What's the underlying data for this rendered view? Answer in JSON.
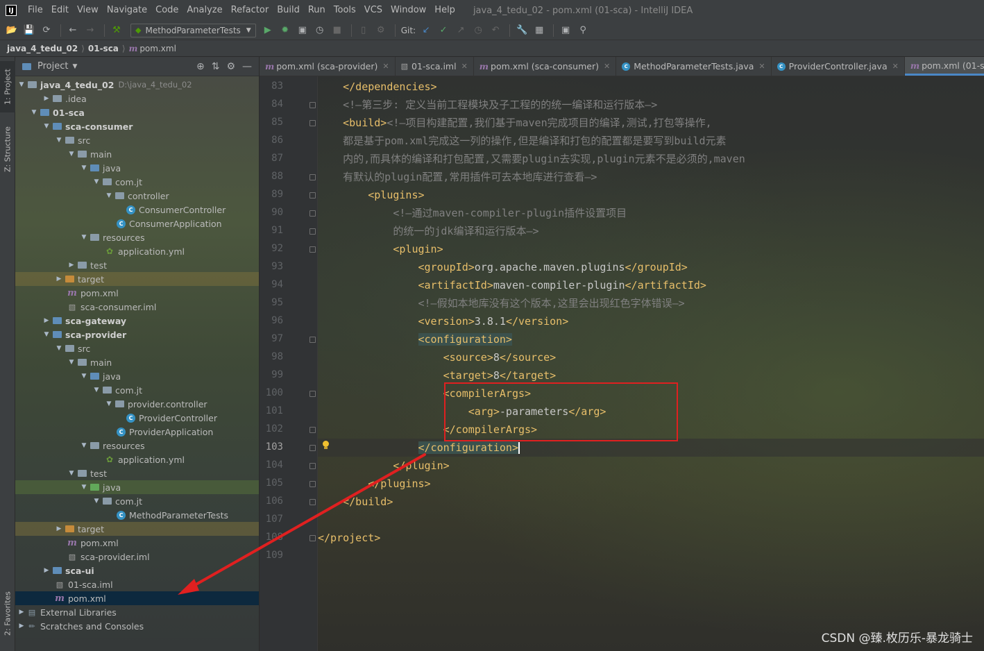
{
  "menubar": {
    "logo": "IJ",
    "items": [
      "File",
      "Edit",
      "View",
      "Navigate",
      "Code",
      "Analyze",
      "Refactor",
      "Build",
      "Run",
      "Tools",
      "VCS",
      "Window",
      "Help"
    ],
    "title": "java_4_tedu_02 - pom.xml (01-sca) - IntelliJ IDEA"
  },
  "toolbar": {
    "run_config": "MethodParameterTests",
    "git_label": "Git:"
  },
  "breadcrumb": {
    "items": [
      "java_4_tedu_02",
      "01-sca",
      "pom.xml"
    ]
  },
  "left_strip": {
    "project": "1: Project",
    "structure": "Z: Structure",
    "favorites": "2: Favorites"
  },
  "project_panel": {
    "title": "Project",
    "tree": [
      {
        "label": "java_4_tedu_02",
        "path": "D:\\java_4_tedu_02"
      },
      {
        "label": ".idea"
      },
      {
        "label": "01-sca"
      },
      {
        "label": "sca-consumer"
      },
      {
        "label": "src"
      },
      {
        "label": "main"
      },
      {
        "label": "java"
      },
      {
        "label": "com.jt"
      },
      {
        "label": "controller"
      },
      {
        "label": "ConsumerController"
      },
      {
        "label": "ConsumerApplication"
      },
      {
        "label": "resources"
      },
      {
        "label": "application.yml"
      },
      {
        "label": "test"
      },
      {
        "label": "target"
      },
      {
        "label": "pom.xml"
      },
      {
        "label": "sca-consumer.iml"
      },
      {
        "label": "sca-gateway"
      },
      {
        "label": "sca-provider"
      },
      {
        "label": "src"
      },
      {
        "label": "main"
      },
      {
        "label": "java"
      },
      {
        "label": "com.jt"
      },
      {
        "label": "provider.controller"
      },
      {
        "label": "ProviderController"
      },
      {
        "label": "ProviderApplication"
      },
      {
        "label": "resources"
      },
      {
        "label": "application.yml"
      },
      {
        "label": "test"
      },
      {
        "label": "java"
      },
      {
        "label": "com.jt"
      },
      {
        "label": "MethodParameterTests"
      },
      {
        "label": "target"
      },
      {
        "label": "pom.xml"
      },
      {
        "label": "sca-provider.iml"
      },
      {
        "label": "sca-ui"
      },
      {
        "label": "01-sca.iml"
      },
      {
        "label": "pom.xml"
      },
      {
        "label": "External Libraries"
      },
      {
        "label": "Scratches and Consoles"
      }
    ]
  },
  "tabs": [
    {
      "label": "pom.xml (sca-provider)"
    },
    {
      "label": "01-sca.iml"
    },
    {
      "label": "pom.xml (sca-consumer)"
    },
    {
      "label": "MethodParameterTests.java"
    },
    {
      "label": "ProviderController.java"
    },
    {
      "label": "pom.xml (01-sca)"
    }
  ],
  "editor": {
    "line_numbers": [
      "83",
      "84",
      "85",
      "86",
      "87",
      "88",
      "89",
      "90",
      "91",
      "92",
      "93",
      "94",
      "95",
      "96",
      "97",
      "98",
      "99",
      "100",
      "101",
      "102",
      "103",
      "104",
      "105",
      "106",
      "107",
      "108",
      "109"
    ],
    "current_line": "103",
    "lines": [
      {
        "indent": "    ",
        "parts": [
          [
            "tag",
            "</dependencies>"
          ]
        ]
      },
      {
        "indent": "    ",
        "parts": [
          [
            "cmt",
            "<!—第三步: 定义当前工程模块及子工程的的统一编译和运行版本—>"
          ]
        ]
      },
      {
        "indent": "    ",
        "parts": [
          [
            "tag",
            "<build>"
          ],
          [
            "cmt",
            "<!—项目构建配置,我们基于maven完成项目的编译,测试,打包等操作,"
          ]
        ]
      },
      {
        "indent": "    ",
        "parts": [
          [
            "cmt",
            "都是基于pom.xml完成这一列的操作,但是编译和打包的配置都是要写到build元素"
          ]
        ]
      },
      {
        "indent": "    ",
        "parts": [
          [
            "cmt",
            "内的,而具体的编译和打包配置,又需要plugin去实现,plugin元素不是必须的,maven"
          ]
        ]
      },
      {
        "indent": "    ",
        "parts": [
          [
            "cmt",
            "有默认的plugin配置,常用插件可去本地库进行查看—>"
          ]
        ]
      },
      {
        "indent": "        ",
        "parts": [
          [
            "tag",
            "<plugins>"
          ]
        ]
      },
      {
        "indent": "            ",
        "parts": [
          [
            "cmt",
            "<!—通过maven-compiler-plugin插件设置项目"
          ]
        ]
      },
      {
        "indent": "            ",
        "parts": [
          [
            "cmt",
            "的统一的jdk编译和运行版本—>"
          ]
        ]
      },
      {
        "indent": "            ",
        "parts": [
          [
            "tag",
            "<plugin>"
          ]
        ]
      },
      {
        "indent": "                ",
        "parts": [
          [
            "tag",
            "<groupId>"
          ],
          [
            "txt",
            "org.apache.maven.plugins"
          ],
          [
            "tag",
            "</groupId>"
          ]
        ]
      },
      {
        "indent": "                ",
        "parts": [
          [
            "tag",
            "<artifactId>"
          ],
          [
            "txt",
            "maven-compiler-plugin"
          ],
          [
            "tag",
            "</artifactId>"
          ]
        ]
      },
      {
        "indent": "                ",
        "parts": [
          [
            "cmt",
            "<!—假如本地库没有这个版本,这里会出现红色字体错误—>"
          ]
        ]
      },
      {
        "indent": "                ",
        "parts": [
          [
            "tag",
            "<version>"
          ],
          [
            "txt",
            "3.8.1"
          ],
          [
            "tag",
            "</version>"
          ]
        ]
      },
      {
        "indent": "                ",
        "parts": [
          [
            "taghl",
            "<configuration>"
          ]
        ]
      },
      {
        "indent": "                    ",
        "parts": [
          [
            "tag",
            "<source>"
          ],
          [
            "txt",
            "8"
          ],
          [
            "tag",
            "</source>"
          ]
        ]
      },
      {
        "indent": "                    ",
        "parts": [
          [
            "tag",
            "<target>"
          ],
          [
            "txt",
            "8"
          ],
          [
            "tag",
            "</target>"
          ]
        ]
      },
      {
        "indent": "                    ",
        "parts": [
          [
            "tag",
            "<compilerArgs>"
          ]
        ]
      },
      {
        "indent": "                        ",
        "parts": [
          [
            "tag",
            "<arg>"
          ],
          [
            "txt",
            "-parameters"
          ],
          [
            "tag",
            "</arg>"
          ]
        ]
      },
      {
        "indent": "                    ",
        "parts": [
          [
            "tag",
            "</compilerArgs>"
          ]
        ]
      },
      {
        "indent": "                ",
        "parts": [
          [
            "taghl",
            "</configuration>"
          ],
          [
            "cursor",
            ""
          ]
        ]
      },
      {
        "indent": "            ",
        "parts": [
          [
            "tag",
            "</plugin>"
          ]
        ]
      },
      {
        "indent": "        ",
        "parts": [
          [
            "tag",
            "</plugins>"
          ]
        ]
      },
      {
        "indent": "    ",
        "parts": [
          [
            "tag",
            "</build>"
          ]
        ]
      },
      {
        "indent": "",
        "parts": []
      },
      {
        "indent": "",
        "parts": [
          [
            "tag",
            "</project>"
          ]
        ]
      },
      {
        "indent": "",
        "parts": []
      }
    ]
  },
  "watermark": "CSDN @臻.枚历乐-暴龙骑士",
  "colors": {
    "annotation": "#e02020",
    "tag": "#e8bf6a",
    "comment": "#808080",
    "selection": "#0d293e"
  }
}
